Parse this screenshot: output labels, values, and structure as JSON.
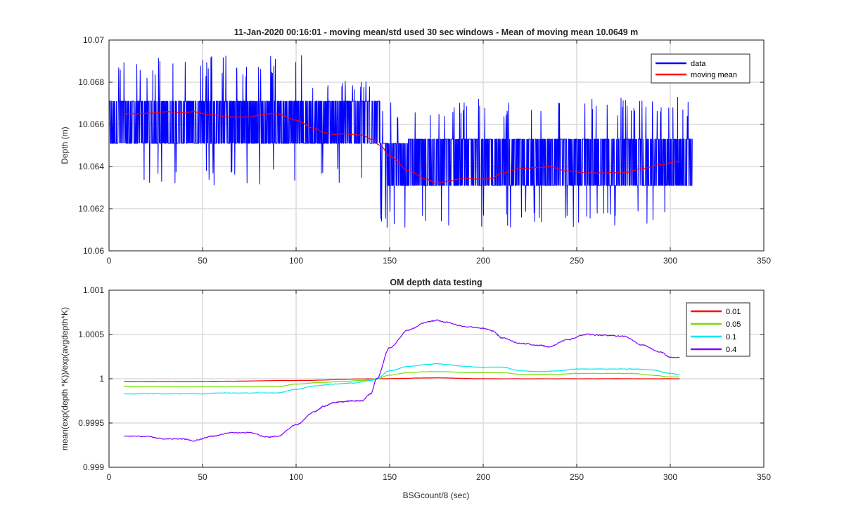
{
  "chart_data": [
    {
      "type": "line",
      "title": "11-Jan-2020 00:16:01 - moving mean/std used 30 sec windows - Mean of moving mean 10.0649 m",
      "xlabel": "",
      "ylabel": "Depth (m)",
      "xlim": [
        0,
        350
      ],
      "ylim": [
        10.06,
        10.07
      ],
      "xticks": [
        "0",
        "50",
        "100",
        "150",
        "200",
        "250",
        "300",
        "350"
      ],
      "yticks": [
        "10.06",
        "10.062",
        "10.064",
        "10.066",
        "10.068",
        "10.07"
      ],
      "grid": true,
      "legend_position": "top-right",
      "series": [
        {
          "name": "data",
          "color": "#0000ff",
          "style": "noisy-quantized",
          "x_range": [
            0,
            312
          ],
          "segments": [
            {
              "x_from": 0,
              "x_to": 104,
              "low": 10.0651,
              "high": 10.0671,
              "spike_high": 10.0693,
              "spike_low": 10.0631
            },
            {
              "x_from": 104,
              "x_to": 145,
              "low": 10.0651,
              "high": 10.0671,
              "spike_high": 10.0681,
              "spike_low": 10.0631
            },
            {
              "x_from": 145,
              "x_to": 160,
              "low": 10.0631,
              "high": 10.0651,
              "spike_high": 10.0671,
              "spike_low": 10.0611
            },
            {
              "x_from": 160,
              "x_to": 312,
              "low": 10.0631,
              "high": 10.0653,
              "spike_high": 10.0673,
              "spike_low": 10.0611
            }
          ]
        },
        {
          "name": "moving mean",
          "color": "#ff0000",
          "x": [
            8,
            15,
            25,
            30,
            40,
            45,
            55,
            65,
            75,
            85,
            90,
            100,
            110,
            115,
            120,
            125,
            135,
            140,
            145,
            150,
            160,
            170,
            175,
            180,
            190,
            200,
            205,
            210,
            220,
            230,
            235,
            245,
            255,
            265,
            275,
            285,
            295,
            305
          ],
          "y": [
            10.0665,
            10.0665,
            10.06655,
            10.0666,
            10.06655,
            10.0666,
            10.06645,
            10.06635,
            10.06635,
            10.0665,
            10.0665,
            10.0662,
            10.0658,
            10.0656,
            10.06553,
            10.06555,
            10.0655,
            10.0653,
            10.065,
            10.0645,
            10.0638,
            10.0634,
            10.0632,
            10.0633,
            10.06343,
            10.0634,
            10.06345,
            10.0637,
            10.0639,
            10.06395,
            10.064,
            10.0638,
            10.0637,
            10.0637,
            10.0637,
            10.0639,
            10.0641,
            10.06425
          ]
        }
      ]
    },
    {
      "type": "line",
      "title": "OM depth data testing",
      "xlabel": "BSGcount/8 (sec)",
      "ylabel": "mean(exp(depth *K))/exp(avgdepth*K)",
      "xlim": [
        0,
        350
      ],
      "ylim": [
        0.999,
        1.001
      ],
      "xticks": [
        "0",
        "50",
        "100",
        "150",
        "200",
        "250",
        "300",
        "350"
      ],
      "yticks": [
        "0.999",
        "0.9995",
        "1",
        "1.0005",
        "1.001"
      ],
      "grid": true,
      "legend_position": "top-right",
      "series": [
        {
          "name": "0.01",
          "color": "#ff0000",
          "x": [
            8,
            50,
            100,
            143,
            175,
            200,
            250,
            305
          ],
          "y": [
            0.99997,
            0.99997,
            0.99998,
            1.0,
            1.00001,
            1.0,
            1.0,
            1.0
          ]
        },
        {
          "name": "0.05",
          "color": "#77dd00",
          "x": [
            8,
            30,
            50,
            70,
            80,
            90,
            100,
            115,
            125,
            135,
            143,
            150,
            160,
            170,
            180,
            190,
            200,
            210,
            220,
            230,
            240,
            250,
            260,
            270,
            280,
            290,
            300,
            305
          ],
          "y": [
            0.99991,
            0.99991,
            0.99991,
            0.99991,
            0.99991,
            0.99991,
            0.99994,
            0.99996,
            0.99997,
            0.99998,
            1.0,
            1.00004,
            1.00007,
            1.00008,
            1.00008,
            1.00007,
            1.00007,
            1.00007,
            1.00005,
            1.00005,
            1.00005,
            1.00006,
            1.00006,
            1.00006,
            1.00006,
            1.00004,
            1.00002,
            1.00002
          ]
        },
        {
          "name": "0.1",
          "color": "#00e5ee",
          "x": [
            8,
            30,
            50,
            60,
            70,
            80,
            90,
            100,
            110,
            120,
            130,
            140,
            143,
            150,
            160,
            170,
            175,
            180,
            190,
            200,
            210,
            220,
            230,
            240,
            250,
            260,
            270,
            280,
            290,
            300,
            305
          ],
          "y": [
            0.99983,
            0.99983,
            0.99983,
            0.99984,
            0.99984,
            0.99984,
            0.99984,
            0.99988,
            0.99992,
            0.99994,
            0.99995,
            0.99998,
            1.0,
            1.00009,
            1.00014,
            1.00016,
            1.00017,
            1.00016,
            1.00014,
            1.00013,
            1.00013,
            1.00009,
            1.00008,
            1.00009,
            1.00011,
            1.00011,
            1.00011,
            1.00011,
            1.0001,
            1.00006,
            1.00005
          ]
        },
        {
          "name": "0.4",
          "color": "#7f00ff",
          "x": [
            8,
            20,
            30,
            40,
            45,
            55,
            65,
            75,
            85,
            90,
            100,
            110,
            115,
            120,
            125,
            130,
            135,
            140,
            143,
            150,
            160,
            170,
            175,
            180,
            190,
            200,
            205,
            210,
            220,
            230,
            235,
            245,
            255,
            265,
            275,
            285,
            295,
            300,
            305
          ],
          "y": [
            0.99935,
            0.99935,
            0.99932,
            0.99932,
            0.9993,
            0.99935,
            0.99939,
            0.99939,
            0.99934,
            0.99935,
            0.99948,
            0.99963,
            0.99969,
            0.99973,
            0.99974,
            0.99975,
            0.99975,
            0.99983,
            1.0,
            1.00035,
            1.00055,
            1.00064,
            1.00066,
            1.00064,
            1.00059,
            1.00057,
            1.00054,
            1.00046,
            1.0004,
            1.00038,
            1.00036,
            1.00044,
            1.0005,
            1.00049,
            1.00048,
            1.00038,
            1.0003,
            1.00024,
            1.00024
          ]
        }
      ]
    }
  ]
}
